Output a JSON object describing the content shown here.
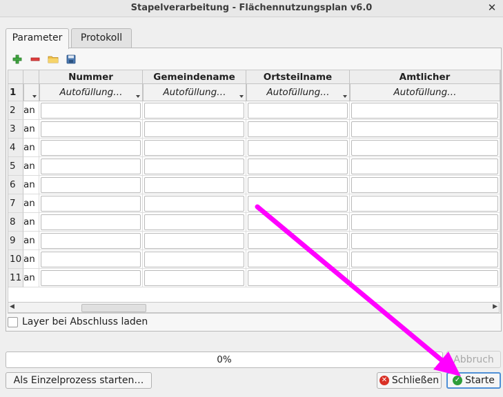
{
  "window": {
    "title": "Stapelverarbeitung - Flächennutzungsplan v6.0",
    "close_glyph": "✕"
  },
  "tabs": [
    {
      "label": "Parameter"
    },
    {
      "label": "Protokoll"
    }
  ],
  "toolbar": [
    {
      "icon": "add-row-icon",
      "color": "#2e9d2e"
    },
    {
      "icon": "remove-row-icon",
      "color": "#d6302c"
    },
    {
      "icon": "open-folder-icon",
      "color": "#e8b33a"
    },
    {
      "icon": "save-icon",
      "color": "#3f6ea8"
    }
  ],
  "table": {
    "columns": [
      "Nummer",
      "Gemeindename",
      "Ortsteilname",
      "Amtlicher Gemeindeschlüssel"
    ],
    "autofill_row_label": "1",
    "autofill": [
      "Autofüllung…",
      "Autofüllung…",
      "Autofüllung…",
      "Autofüllung…"
    ],
    "rows": [
      {
        "num": "2",
        "mode": "an"
      },
      {
        "num": "3",
        "mode": "an"
      },
      {
        "num": "4",
        "mode": "an"
      },
      {
        "num": "5",
        "mode": "an"
      },
      {
        "num": "6",
        "mode": "an"
      },
      {
        "num": "7",
        "mode": "an"
      },
      {
        "num": "8",
        "mode": "an"
      },
      {
        "num": "9",
        "mode": "an"
      },
      {
        "num": "10",
        "mode": "an"
      },
      {
        "num": "11",
        "mode": "an"
      }
    ]
  },
  "load_layer_checkbox": {
    "label": "Layer bei Abschluss laden",
    "checked": false
  },
  "progress": {
    "value": 0,
    "text": "0%"
  },
  "buttons": {
    "abort": "Abbruch",
    "single_process": "Als Einzelprozess starten…",
    "close": "Schließen",
    "start": "Starte"
  },
  "annotation_color": "#ff00ff"
}
